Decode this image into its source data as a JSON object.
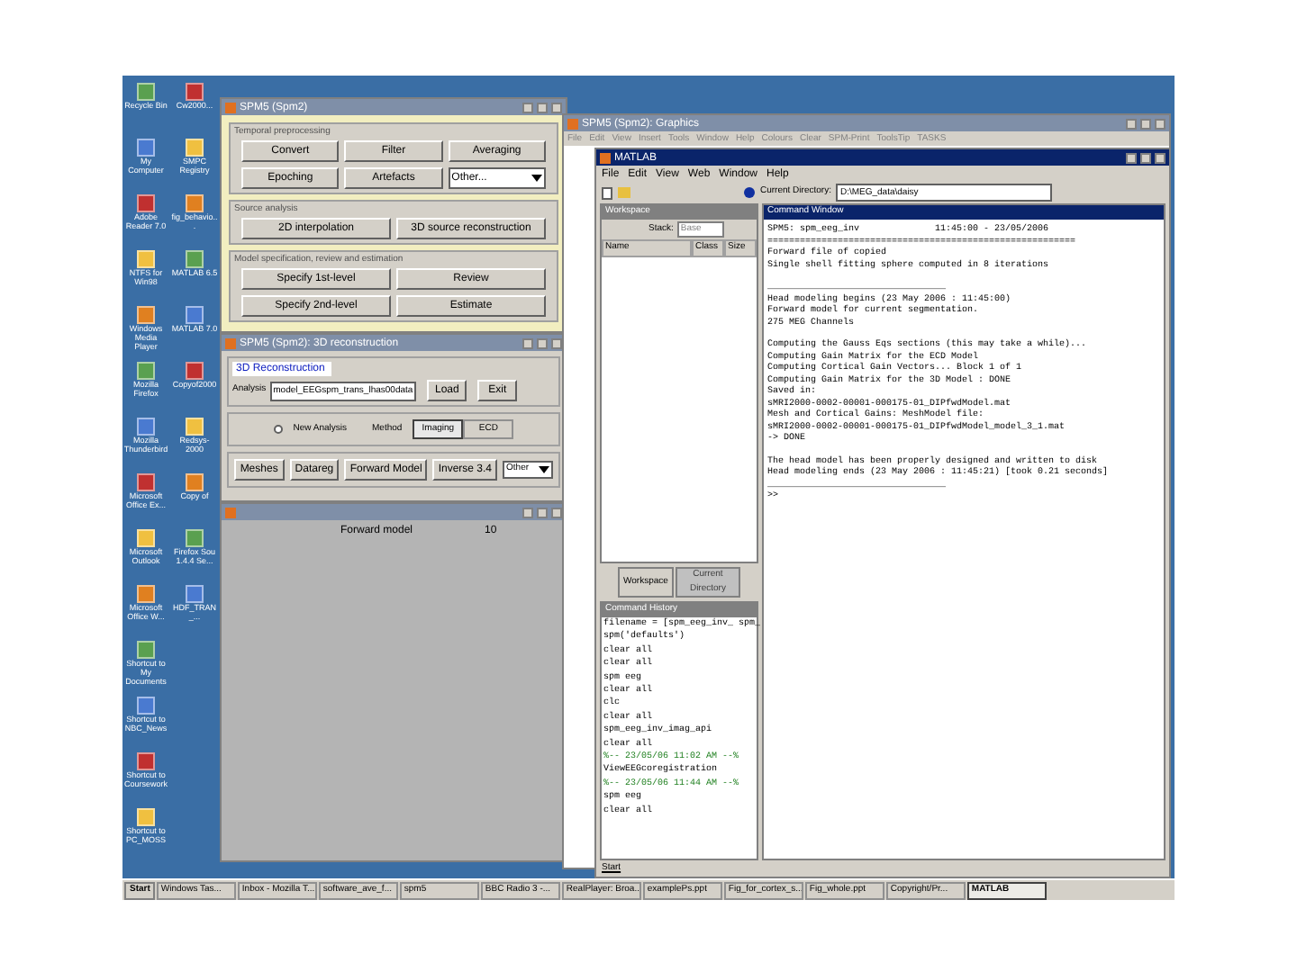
{
  "desktop_icons_left": [
    {
      "label": "Recycle Bin"
    },
    {
      "label": "My Computer"
    },
    {
      "label": "Adobe Reader 7.0"
    },
    {
      "label": "NTFS for Win98"
    },
    {
      "label": "Windows Media Player"
    },
    {
      "label": "Mozilla Firefox"
    },
    {
      "label": "Mozilla Thunderbird"
    },
    {
      "label": "Microsoft Office Ex..."
    },
    {
      "label": "Microsoft Outlook"
    },
    {
      "label": "Microsoft Office W..."
    },
    {
      "label": "Shortcut to My Documents"
    },
    {
      "label": "Shortcut to NBC_News"
    },
    {
      "label": "Shortcut to Coursework"
    },
    {
      "label": "Shortcut to PC_MOSS"
    }
  ],
  "desktop_icons_right": [
    {
      "label": "Cw2000..."
    },
    {
      "label": "SMPC Registry"
    },
    {
      "label": "fig_behavio..."
    },
    {
      "label": "MATLAB 6.5"
    },
    {
      "label": "MATLAB 7.0"
    },
    {
      "label": "Copyof2000"
    },
    {
      "label": "Redsys-2000"
    },
    {
      "label": "Copy of"
    },
    {
      "label": "Firefox Sou 1.4.4 Se..."
    },
    {
      "label": "HDF_TRAN_..."
    }
  ],
  "spm_menu": {
    "title": "SPM5 (Spm2)",
    "sections": [
      {
        "title": "Temporal preprocessing",
        "buttons": [
          "Convert",
          "Filter",
          "Averaging",
          "Epoching",
          "Artefacts"
        ],
        "dropdown": "Other..."
      },
      {
        "title": "Source analysis",
        "buttons": [
          "2D interpolation",
          "3D source reconstruction"
        ]
      },
      {
        "title": "Model specification, review and estimation",
        "buttons": [
          "Specify 1st-level",
          "Review",
          "Specify 2nd-level",
          "Estimate"
        ]
      }
    ]
  },
  "recon_window": {
    "title": "SPM5 (Spm2): 3D reconstruction",
    "heading": "3D Reconstruction",
    "field_label": "Analysis",
    "field_value": "model_EEGspm_trans_lhas00data",
    "buttons": [
      "Load",
      "Exit"
    ],
    "new_analysis": {
      "label": "New Analysis",
      "selected": false
    },
    "method_label": "Method",
    "methods": [
      {
        "label": "Imaging",
        "selected": true
      },
      {
        "label": "ECD",
        "selected": false
      }
    ],
    "steps": [
      "Meshes",
      "Datareg",
      "Forward Model",
      "Inverse 3.4"
    ],
    "dropdown": "Other"
  },
  "model_window": {
    "label": "Forward model",
    "value": "10"
  },
  "graphics_window": {
    "title": "SPM5 (Spm2): Graphics",
    "menu": [
      "File",
      "Edit",
      "View",
      "Insert",
      "Tools",
      "Window",
      "Help",
      "Colours",
      "Clear",
      "SPM-Print",
      "ToolsTip",
      "TASKS"
    ]
  },
  "matlab": {
    "title": "MATLAB",
    "menu": [
      "File",
      "Edit",
      "View",
      "Web",
      "Window",
      "Help"
    ],
    "current_directory_label": "Current Directory:",
    "current_directory": "D:\\MEG_data\\daisy",
    "workspace": {
      "title": "Workspace",
      "stack_label": "Stack:",
      "stack": "Base",
      "columns": [
        "Name",
        "Class",
        "Size"
      ]
    },
    "tabs": [
      {
        "label": "Workspace",
        "selected": true
      },
      {
        "label": "Current Directory",
        "selected": false
      }
    ],
    "history": {
      "title": "Command History",
      "lines": [
        {
          "text": "filename = [spm_eeg_inv_ spm_",
          "kind": "command"
        },
        {
          "text": "spm('defaults')",
          "kind": "command"
        },
        {
          "text": "clear all",
          "kind": "command"
        },
        {
          "text": "clear all",
          "kind": "command"
        },
        {
          "text": "spm eeg",
          "kind": "command"
        },
        {
          "text": "clear all",
          "kind": "command"
        },
        {
          "text": "clc",
          "kind": "command"
        },
        {
          "text": "clear all",
          "kind": "command"
        },
        {
          "text": "spm_eeg_inv_imag_api",
          "kind": "command"
        },
        {
          "text": "clear all",
          "kind": "command"
        },
        {
          "text": "%-- 23/05/06 11:02 AM --%",
          "kind": "session"
        },
        {
          "text": "ViewEEGcoregistration",
          "kind": "command"
        },
        {
          "text": "%-- 23/05/06 11:44 AM --%",
          "kind": "session"
        },
        {
          "text": "spm eeg",
          "kind": "command"
        },
        {
          "text": "clear all",
          "kind": "command"
        }
      ]
    },
    "command_window": {
      "title": "Command Window",
      "blocks": [
        [
          "SPM5: spm_eeg_inv              11:45:00 - 23/05/2006",
          "=========================================================",
          "Forward file of copied",
          "Single shell fitting sphere computed in 8 iterations"
        ],
        [
          "_________________________________",
          "Head modeling begins (23 May 2006 : 11:45:00)",
          "Forward model for current segmentation.",
          "275 MEG Channels"
        ],
        [
          "Computing the Gauss Eqs sections (this may take a while)...",
          "Computing Gain Matrix for the ECD Model",
          "Computing Cortical Gain Vectors... Block 1 of 1",
          "Computing Gain Matrix for the 3D Model : DONE",
          "Saved in:",
          "sMRI2000-0002-00001-000175-01_DIPfwdModel.mat",
          "Mesh and Cortical Gains: MeshModel file:",
          "sMRI2000-0002-00001-000175-01_DIPfwdModel_model_3_1.mat",
          "-> DONE"
        ],
        [
          "The head model has been properly designed and written to disk",
          "Head modeling ends (23 May 2006 : 11:45:21) [took 0.21 seconds]",
          "_________________________________",
          ">>"
        ]
      ]
    },
    "start_button": "Start"
  },
  "taskbar": {
    "start": "Start",
    "tasks": [
      {
        "label": "Windows Tas...",
        "selected": false
      },
      {
        "label": "Inbox - Mozilla T...",
        "selected": false
      },
      {
        "label": "software_ave_f...",
        "selected": false
      },
      {
        "label": "spm5",
        "selected": false
      },
      {
        "label": "BBC Radio 3 -...",
        "selected": false
      },
      {
        "label": "RealPlayer: Broa...",
        "selected": false
      },
      {
        "label": "examplePs.ppt",
        "selected": false
      },
      {
        "label": "Fig_for_cortex_s...",
        "selected": false
      },
      {
        "label": "Fig_whole.ppt",
        "selected": false
      },
      {
        "label": "Copyright/Pr...",
        "selected": false
      },
      {
        "label": "MATLAB",
        "selected": true
      }
    ]
  }
}
